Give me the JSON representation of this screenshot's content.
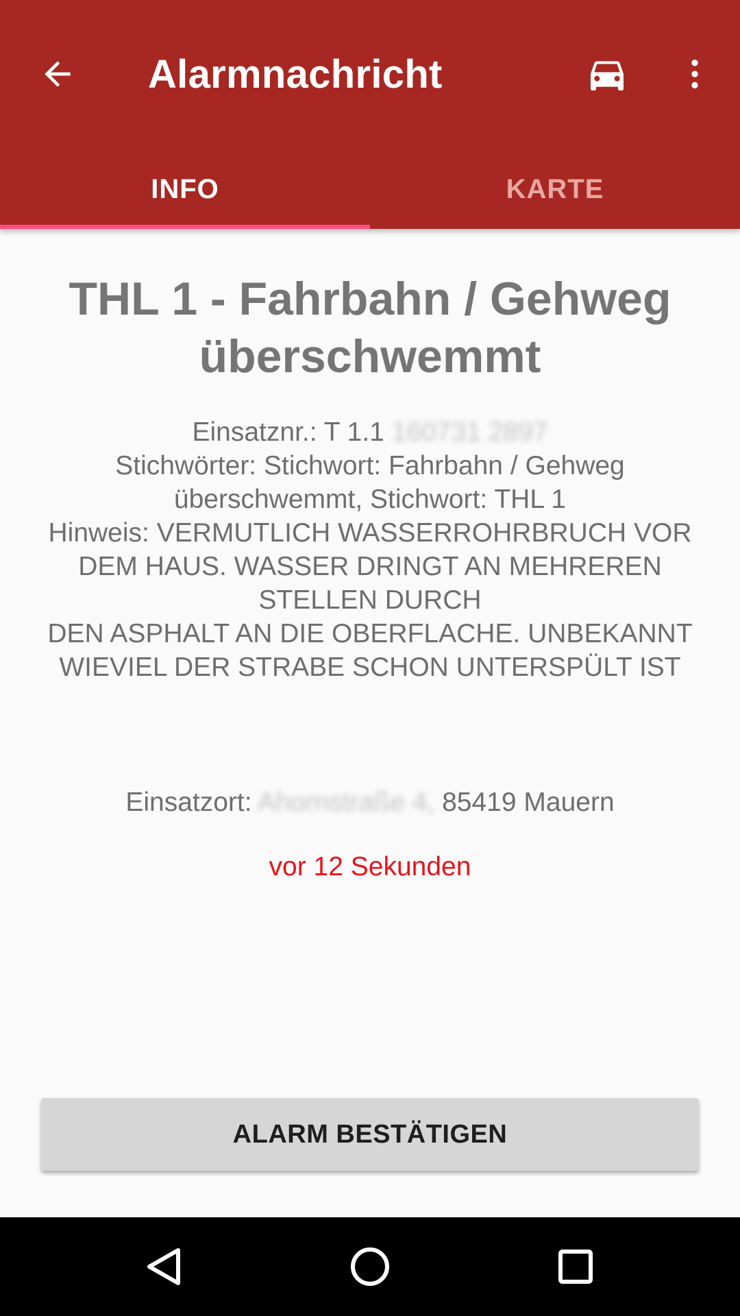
{
  "toolbar": {
    "title": "Alarmnachricht",
    "back_icon": "arrow-back-icon",
    "car_icon": "car-icon",
    "more_icon": "more-vert-icon"
  },
  "tabs": [
    {
      "label": "INFO",
      "active": true
    },
    {
      "label": "KARTE",
      "active": false
    }
  ],
  "alarm": {
    "headline": "THL 1 - Fahrbahn / Gehweg überschwemmt",
    "einsatznr_label": "Einsatznr.: T 1.1",
    "einsatznr_redacted": "160731 2897",
    "stichwoerter": "Stichwörter: Stichwort: Fahrbahn / Gehweg überschwemmt, Stichwort: THL 1",
    "hinweis_lines": [
      "Hinweis: VERMUTLICH WASSERROHRBRUCH VOR DEM HAUS. WASSER DRINGT AN MEHREREN STELLEN DURCH",
      "DEN ASPHALT AN DIE OBERFLACHE. UNBEKANNT WIEVIEL DER STRABE SCHON UNTERSPÜLT IST"
    ],
    "einsatzort_label": "Einsatzort:",
    "einsatzort_redacted": "Ahornstraße 4,",
    "einsatzort_city": "85419 Mauern",
    "time_ago": "vor 12 Sekunden"
  },
  "actions": {
    "confirm_label": "ALARM BESTÄTIGEN"
  },
  "colors": {
    "appbar": "#a72822",
    "tab_indicator": "#ff4d80",
    "time_text": "#e8141c",
    "body_text": "#6e6e6e"
  },
  "navbar": {
    "back_icon": "nav-back-icon",
    "home_icon": "nav-home-icon",
    "recents_icon": "nav-recents-icon"
  }
}
